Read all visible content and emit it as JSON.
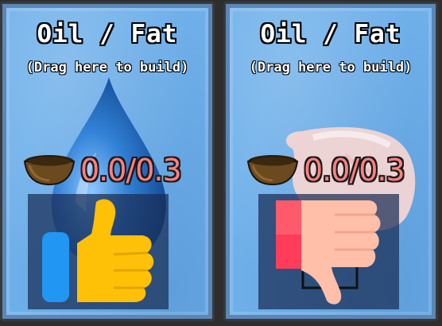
{
  "cards": [
    {
      "title": "Oil / Fat",
      "subtitle": "(Drag here to build)",
      "resource_amount": "0.0/0.3",
      "resource_icon": "bowl-icon",
      "background_icon": "oil-drop-icon",
      "verdict_icon": "thumbs-up-icon"
    },
    {
      "title": "Oil / Fat",
      "subtitle": "(Drag here to build)",
      "resource_amount": "0.0/0.3",
      "resource_icon": "bowl-icon",
      "background_icon": "fat-lump-icon",
      "verdict_icon": "thumbs-down-icon"
    }
  ],
  "colors": {
    "card_background": "#6fb0ea",
    "amount_text": "#ff8080",
    "thumbs_up": "#ffc107",
    "thumbs_up_cuff": "#2196f3",
    "thumbs_down": "#ffbfa8",
    "thumbs_down_cuff": "#ff3d5a"
  }
}
